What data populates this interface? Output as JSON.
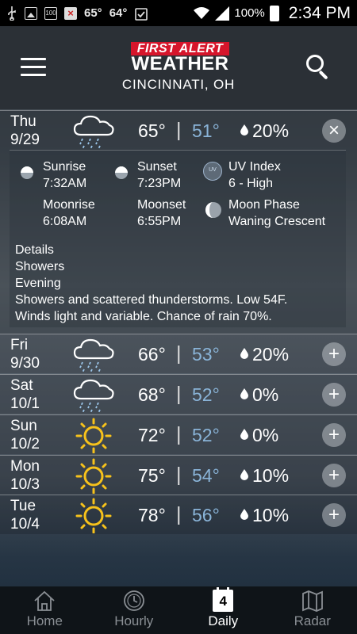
{
  "status_bar": {
    "temp_current": "65°",
    "temp_feels": "64°",
    "battery": "100%",
    "time": "2:34 PM",
    "notif_count": "100"
  },
  "header": {
    "logo_top": "FIRST ALERT",
    "logo_bottom": "WEATHER",
    "city": "CINCINNATI, OH",
    "brand_color": "#d6152b"
  },
  "forecast": [
    {
      "day": "Thu",
      "date": "9/29",
      "icon": "showers-icon",
      "hi": "65°",
      "sep": "|",
      "lo": "51°",
      "pop": "20%",
      "toggle": "×",
      "expanded": true
    },
    {
      "day": "Fri",
      "date": "9/30",
      "icon": "showers-icon",
      "hi": "66°",
      "sep": "|",
      "lo": "53°",
      "pop": "20%",
      "toggle": "+"
    },
    {
      "day": "Sat",
      "date": "10/1",
      "icon": "showers-icon",
      "hi": "68°",
      "sep": "|",
      "lo": "52°",
      "pop": "0%",
      "toggle": "+"
    },
    {
      "day": "Sun",
      "date": "10/2",
      "icon": "sun-icon",
      "hi": "72°",
      "sep": "|",
      "lo": "52°",
      "pop": "0%",
      "toggle": "+"
    },
    {
      "day": "Mon",
      "date": "10/3",
      "icon": "sun-icon",
      "hi": "75°",
      "sep": "|",
      "lo": "54°",
      "pop": "10%",
      "toggle": "+"
    },
    {
      "day": "Tue",
      "date": "10/4",
      "icon": "sun-icon",
      "hi": "78°",
      "sep": "|",
      "lo": "56°",
      "pop": "10%",
      "toggle": "+"
    }
  ],
  "details": {
    "sunrise_label": "Sunrise",
    "sunrise": "7:32AM",
    "sunset_label": "Sunset",
    "sunset": "7:23PM",
    "uv_label": "UV Index",
    "uv": "6 - High",
    "moonrise_label": "Moonrise",
    "moonrise": "6:08AM",
    "moonset_label": "Moonset",
    "moonset": "6:55PM",
    "moonphase_label": "Moon Phase",
    "moonphase": "Waning Crescent",
    "heading": "Details",
    "condition": "Showers",
    "period": "Evening",
    "line1": "Showers and scattered thunderstorms. Low 54F.",
    "line2": "Winds light and variable. Chance of rain 70%."
  },
  "nav": {
    "home": "Home",
    "hourly": "Hourly",
    "daily": "Daily",
    "daily_day_number": "4",
    "radar": "Radar"
  }
}
